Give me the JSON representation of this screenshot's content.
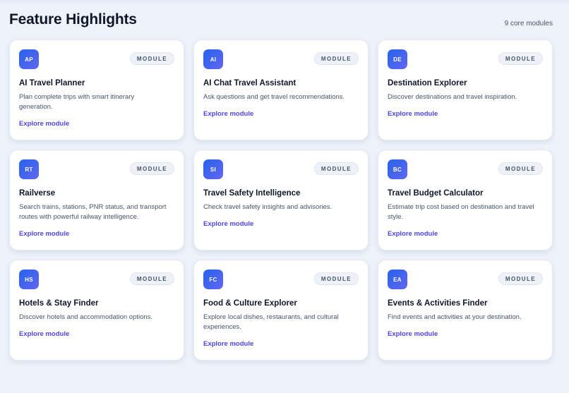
{
  "header": {
    "title": "Feature Highlights",
    "count": "9 core modules"
  },
  "colors": {
    "accent": "#4f46e5",
    "icon_gradient_start": "#2563eb",
    "icon_gradient_end": "#6366f1",
    "background": "#eef3fb"
  },
  "cards": [
    {
      "abbr": "AP",
      "tag": "MODULE",
      "title": "AI Travel Planner",
      "desc": "Plan complete trips with smart itinerary generation.",
      "link": "Explore module"
    },
    {
      "abbr": "AI",
      "tag": "MODULE",
      "title": "AI Chat Travel Assistant",
      "desc": "Ask questions and get travel recommendations.",
      "link": "Explore module"
    },
    {
      "abbr": "DE",
      "tag": "MODULE",
      "title": "Destination Explorer",
      "desc": "Discover destinations and travel inspiration.",
      "link": "Explore module"
    },
    {
      "abbr": "RT",
      "tag": "MODULE",
      "title": "Railverse",
      "desc": "Search trains, stations, PNR status, and transport routes with powerful railway intelligence.",
      "link": "Explore module"
    },
    {
      "abbr": "SI",
      "tag": "MODULE",
      "title": "Travel Safety Intelligence",
      "desc": "Check travel safety insights and advisories.",
      "link": "Explore module"
    },
    {
      "abbr": "BC",
      "tag": "MODULE",
      "title": "Travel Budget Calculator",
      "desc": "Estimate trip cost based on destination and travel style.",
      "link": "Explore module"
    },
    {
      "abbr": "HS",
      "tag": "MODULE",
      "title": "Hotels & Stay Finder",
      "desc": "Discover hotels and accommodation options.",
      "link": "Explore module"
    },
    {
      "abbr": "FC",
      "tag": "MODULE",
      "title": "Food & Culture Explorer",
      "desc": "Explore local dishes, restaurants, and cultural experiences.",
      "link": "Explore module"
    },
    {
      "abbr": "EA",
      "tag": "MODULE",
      "title": "Events & Activities Finder",
      "desc": "Find events and activities at your destination.",
      "link": "Explore module"
    }
  ]
}
